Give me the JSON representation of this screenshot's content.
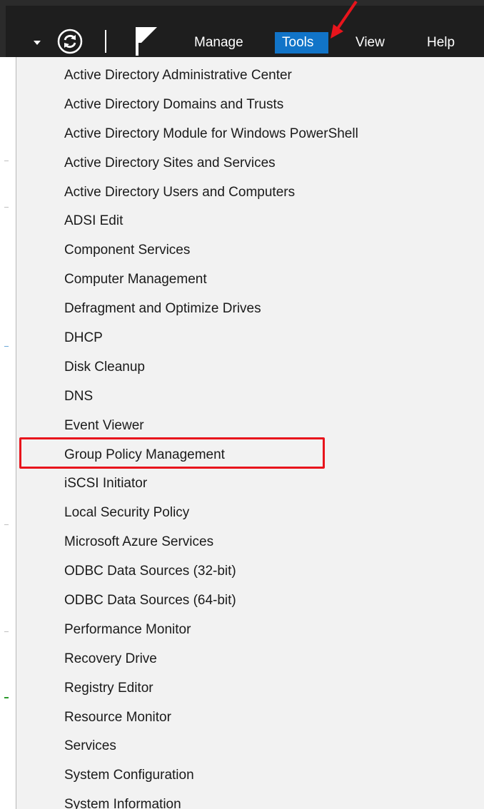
{
  "menubar": {
    "manage_label": "Manage",
    "tools_label": "Tools",
    "view_label": "View",
    "help_label": "Help"
  },
  "icons": {
    "dropdown": "chevron-down-icon",
    "refresh": "refresh-icon",
    "flag": "notifications-flag-icon"
  },
  "colors": {
    "menubar_bg": "#1e1e1e",
    "tools_active_bg": "#1174c8",
    "panel_bg": "#f2f2f2",
    "annotation_red": "#e8141c"
  },
  "tools_menu": {
    "items": [
      {
        "label": "Active Directory Administrative Center"
      },
      {
        "label": "Active Directory Domains and Trusts"
      },
      {
        "label": "Active Directory Module for Windows PowerShell"
      },
      {
        "label": "Active Directory Sites and Services"
      },
      {
        "label": "Active Directory Users and Computers"
      },
      {
        "label": "ADSI Edit"
      },
      {
        "label": "Component Services"
      },
      {
        "label": "Computer Management"
      },
      {
        "label": "Defragment and Optimize Drives"
      },
      {
        "label": "DHCP"
      },
      {
        "label": "Disk Cleanup"
      },
      {
        "label": "DNS"
      },
      {
        "label": "Event Viewer"
      },
      {
        "label": "Group Policy Management"
      },
      {
        "label": "iSCSI Initiator"
      },
      {
        "label": "Local Security Policy"
      },
      {
        "label": "Microsoft Azure Services"
      },
      {
        "label": "ODBC Data Sources (32-bit)"
      },
      {
        "label": "ODBC Data Sources (64-bit)"
      },
      {
        "label": "Performance Monitor"
      },
      {
        "label": "Recovery Drive"
      },
      {
        "label": "Registry Editor"
      },
      {
        "label": "Resource Monitor"
      },
      {
        "label": "Services"
      },
      {
        "label": "System Configuration"
      },
      {
        "label": "System Information"
      }
    ]
  }
}
